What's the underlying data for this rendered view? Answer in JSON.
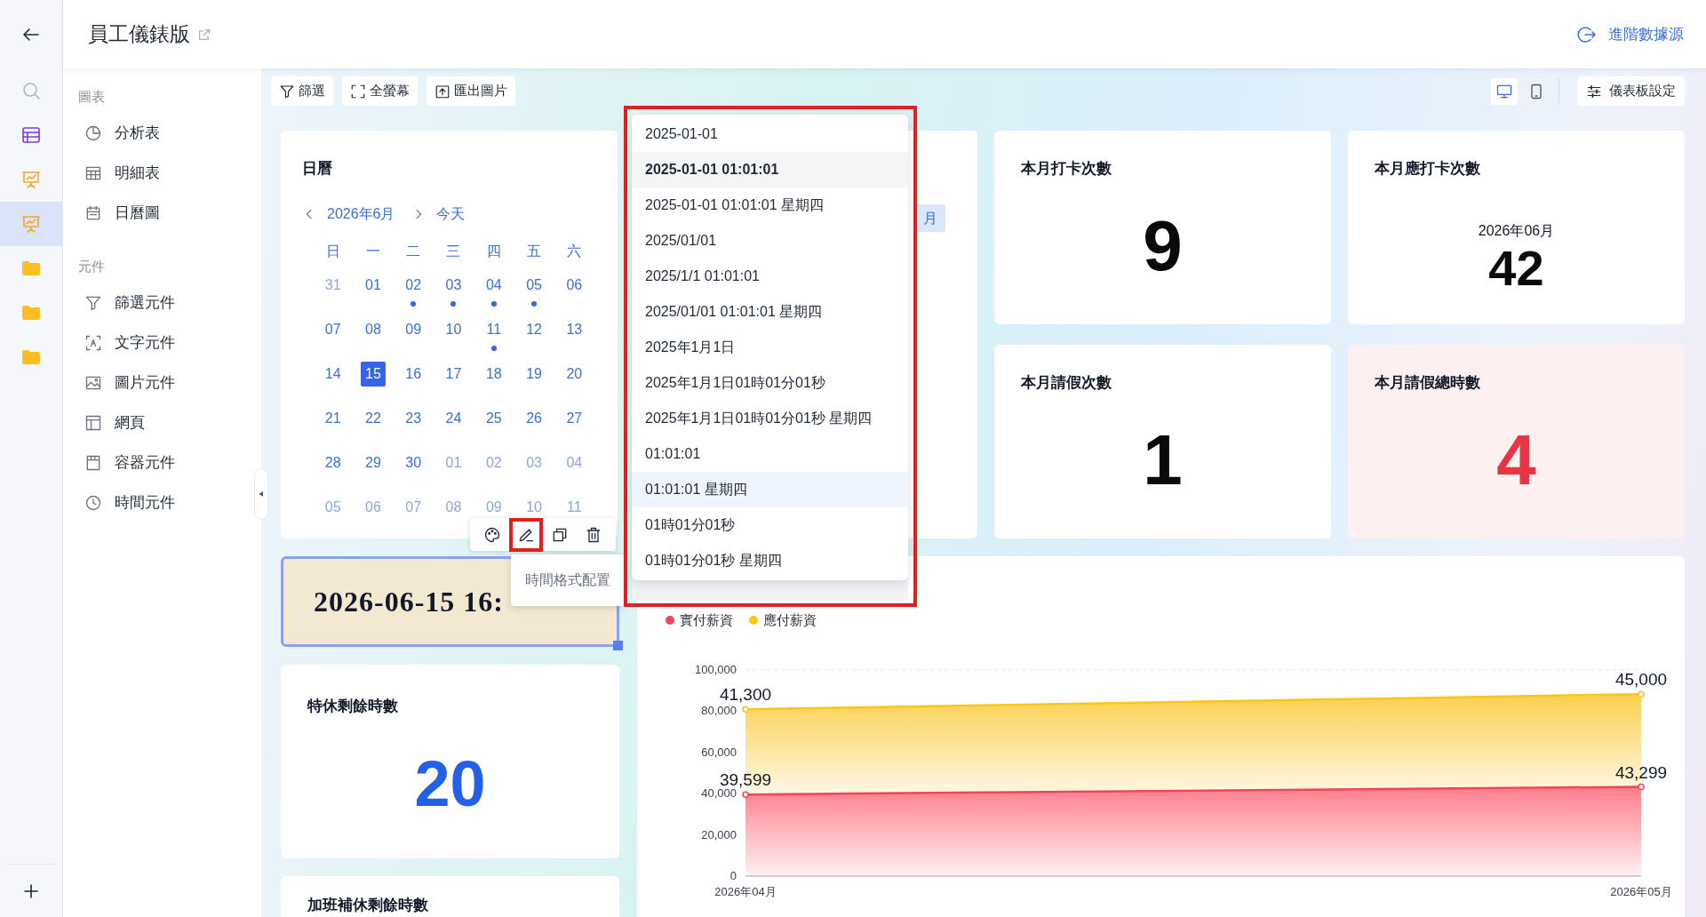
{
  "header": {
    "title": "員工儀錶版",
    "data_source_link": "進階數據源"
  },
  "rail": {
    "items": [
      {
        "kind": "search",
        "selected": false
      },
      {
        "kind": "table",
        "selected": false
      },
      {
        "kind": "dashboard",
        "selected": false
      },
      {
        "kind": "dashboard",
        "selected": true
      },
      {
        "kind": "folder",
        "selected": false
      },
      {
        "kind": "folder",
        "selected": false
      },
      {
        "kind": "folder",
        "selected": false
      }
    ]
  },
  "sidebar": {
    "groups": [
      {
        "title": "圖表",
        "items": [
          {
            "label": "分析表",
            "kind": "pie"
          },
          {
            "label": "明細表",
            "kind": "grid"
          },
          {
            "label": "日曆圖",
            "kind": "calendar"
          }
        ]
      },
      {
        "title": "元件",
        "items": [
          {
            "label": "篩選元件",
            "kind": "filter"
          },
          {
            "label": "文字元件",
            "kind": "text"
          },
          {
            "label": "圖片元件",
            "kind": "image"
          },
          {
            "label": "網頁",
            "kind": "layout"
          },
          {
            "label": "容器元件",
            "kind": "container"
          },
          {
            "label": "時間元件",
            "kind": "clock"
          }
        ]
      }
    ]
  },
  "toolbar": {
    "buttons": [
      {
        "label": "篩選",
        "kind": "filter"
      },
      {
        "label": "全螢幕",
        "kind": "fullscreen"
      },
      {
        "label": "匯出圖片",
        "kind": "export"
      }
    ],
    "view_modes": [
      {
        "kind": "desktop",
        "selected": true
      },
      {
        "kind": "mobile",
        "selected": false
      }
    ],
    "settings": "儀表板設定"
  },
  "calendar_card": {
    "title": "日曆",
    "month": "2026年6月",
    "today": "今天",
    "weekdays": [
      "日",
      "一",
      "二",
      "三",
      "四",
      "五",
      "六"
    ],
    "days": [
      {
        "label": "31",
        "outside": true,
        "selected": false,
        "event": false
      },
      {
        "label": "01",
        "outside": false,
        "selected": false,
        "event": false
      },
      {
        "label": "02",
        "outside": false,
        "selected": false,
        "event": true
      },
      {
        "label": "03",
        "outside": false,
        "selected": false,
        "event": true
      },
      {
        "label": "04",
        "outside": false,
        "selected": false,
        "event": true
      },
      {
        "label": "05",
        "outside": false,
        "selected": false,
        "event": true
      },
      {
        "label": "06",
        "outside": false,
        "selected": false,
        "event": false
      },
      {
        "label": "07",
        "outside": false,
        "selected": false,
        "event": false
      },
      {
        "label": "08",
        "outside": false,
        "selected": false,
        "event": false
      },
      {
        "label": "09",
        "outside": false,
        "selected": false,
        "event": false
      },
      {
        "label": "10",
        "outside": false,
        "selected": false,
        "event": false
      },
      {
        "label": "11",
        "outside": false,
        "selected": false,
        "event": true
      },
      {
        "label": "12",
        "outside": false,
        "selected": false,
        "event": false
      },
      {
        "label": "13",
        "outside": false,
        "selected": false,
        "event": false
      },
      {
        "label": "14",
        "outside": false,
        "selected": false,
        "event": false
      },
      {
        "label": "15",
        "outside": false,
        "selected": true,
        "event": false
      },
      {
        "label": "16",
        "outside": false,
        "selected": false,
        "event": false
      },
      {
        "label": "17",
        "outside": false,
        "selected": false,
        "event": false
      },
      {
        "label": "18",
        "outside": false,
        "selected": false,
        "event": false
      },
      {
        "label": "19",
        "outside": false,
        "selected": false,
        "event": false
      },
      {
        "label": "20",
        "outside": false,
        "selected": false,
        "event": false
      },
      {
        "label": "21",
        "outside": false,
        "selected": false,
        "event": false
      },
      {
        "label": "22",
        "outside": false,
        "selected": false,
        "event": false
      },
      {
        "label": "23",
        "outside": false,
        "selected": false,
        "event": false
      },
      {
        "label": "24",
        "outside": false,
        "selected": false,
        "event": false
      },
      {
        "label": "25",
        "outside": false,
        "selected": false,
        "event": false
      },
      {
        "label": "26",
        "outside": false,
        "selected": false,
        "event": false
      },
      {
        "label": "27",
        "outside": false,
        "selected": false,
        "event": false
      },
      {
        "label": "28",
        "outside": false,
        "selected": false,
        "event": false
      },
      {
        "label": "29",
        "outside": false,
        "selected": false,
        "event": false
      },
      {
        "label": "30",
        "outside": false,
        "selected": false,
        "event": false
      },
      {
        "label": "01",
        "outside": true,
        "selected": false,
        "event": false
      },
      {
        "label": "02",
        "outside": true,
        "selected": false,
        "event": false
      },
      {
        "label": "03",
        "outside": true,
        "selected": false,
        "event": false
      },
      {
        "label": "04",
        "outside": true,
        "selected": false,
        "event": false
      },
      {
        "label": "05",
        "outside": true,
        "selected": false,
        "event": false
      },
      {
        "label": "06",
        "outside": true,
        "selected": false,
        "event": false
      },
      {
        "label": "07",
        "outside": true,
        "selected": false,
        "event": false
      },
      {
        "label": "08",
        "outside": true,
        "selected": false,
        "event": false
      },
      {
        "label": "09",
        "outside": true,
        "selected": false,
        "event": false
      },
      {
        "label": "10",
        "outside": true,
        "selected": false,
        "event": false
      },
      {
        "label": "11",
        "outside": true,
        "selected": false,
        "event": false
      }
    ]
  },
  "middle_card": {
    "view_button": "月"
  },
  "stat_cards": [
    {
      "title": "本月打卡次數",
      "value": "9",
      "kind": "normal"
    },
    {
      "title": "本月應打卡次數",
      "subtitle": "2026年06月",
      "value": "42",
      "kind": "normal"
    },
    {
      "title": "本月請假次數",
      "value": "1",
      "kind": "normal"
    },
    {
      "title": "本月請假總時數",
      "value": "4",
      "kind": "alert"
    }
  ],
  "time_card": {
    "text": "2026-06-15 16:"
  },
  "hours_cards": [
    {
      "title": "特休剩餘時數",
      "value": "20"
    },
    {
      "title": "加班補休剩餘時數"
    }
  ],
  "component_toolbar": {
    "buttons": [
      {
        "kind": "style",
        "highlighted": false
      },
      {
        "kind": "edit",
        "highlighted": true
      },
      {
        "kind": "copy",
        "highlighted": false
      },
      {
        "kind": "delete",
        "highlighted": false
      }
    ],
    "tooltip": "時間格式配置"
  },
  "format_dropdown": {
    "highlighted": true,
    "options": [
      {
        "label": "2025-01-01",
        "selected": false,
        "hovered": false
      },
      {
        "label": "2025-01-01 01:01:01",
        "selected": true,
        "hovered": false
      },
      {
        "label": "2025-01-01 01:01:01 星期四",
        "selected": false,
        "hovered": false
      },
      {
        "label": "2025/01/01",
        "selected": false,
        "hovered": false
      },
      {
        "label": "2025/1/1 01:01:01",
        "selected": false,
        "hovered": false
      },
      {
        "label": "2025/01/01 01:01:01 星期四",
        "selected": false,
        "hovered": false
      },
      {
        "label": "2025年1月1日",
        "selected": false,
        "hovered": false
      },
      {
        "label": "2025年1月1日01時01分01秒",
        "selected": false,
        "hovered": false
      },
      {
        "label": "2025年1月1日01時01分01秒 星期四",
        "selected": false,
        "hovered": false
      },
      {
        "label": "01:01:01",
        "selected": false,
        "hovered": false
      },
      {
        "label": "01:01:01 星期四",
        "selected": false,
        "hovered": true
      },
      {
        "label": "01時01分01秒",
        "selected": false,
        "hovered": false
      },
      {
        "label": "01時01分01秒 星期四",
        "selected": false,
        "hovered": false
      }
    ]
  },
  "salary_chart": {
    "chart_data": {
      "type": "area",
      "stacked": true,
      "categories": [
        "2026年04月",
        "2026年05月"
      ],
      "series": [
        {
          "name": "實付薪資",
          "color": "#f0455a",
          "values": [
            39599,
            43299
          ],
          "value_labels": [
            "39,599",
            "43,299"
          ]
        },
        {
          "name": "應付薪資",
          "color": "#fac61a",
          "values": [
            41300,
            45000
          ],
          "value_labels": [
            "41,300",
            "45,000"
          ]
        }
      ],
      "ylim": [
        0,
        100000
      ],
      "yticks": [
        0,
        {
          "value": 20000,
          "label": "20,000"
        },
        {
          "value": 40000,
          "label": "40,000"
        },
        {
          "value": 60000,
          "label": "60,000"
        },
        {
          "value": 80000,
          "label": "80,000"
        },
        {
          "value": 100000,
          "label": "100,000"
        }
      ]
    }
  }
}
